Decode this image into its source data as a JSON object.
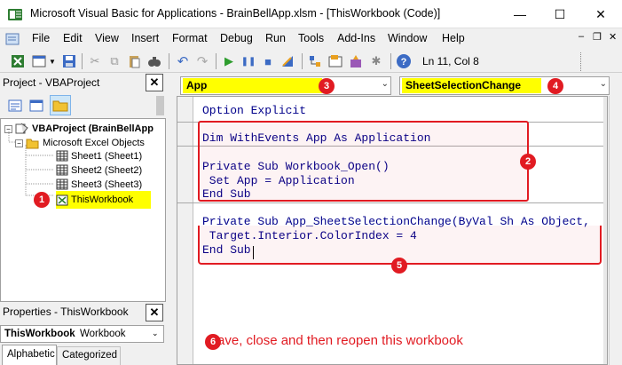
{
  "window": {
    "title": "Microsoft Visual Basic for Applications - BrainBellApp.xlsm - [ThisWorkbook (Code)]",
    "minimize": "—",
    "maximize": "☐",
    "close": "✕"
  },
  "menu": {
    "items": [
      "File",
      "Edit",
      "View",
      "Insert",
      "Format",
      "Debug",
      "Run",
      "Tools",
      "Add-Ins",
      "Window",
      "Help"
    ],
    "doc_min": "–",
    "doc_restore": "❐",
    "doc_close": "✕"
  },
  "toolbar": {
    "status": "Ln 11, Col 8"
  },
  "project": {
    "title": "Project - VBAProject",
    "close": "✕",
    "root": "VBAProject (BrainBellApp",
    "folder": "Microsoft Excel Objects",
    "sheets": [
      "Sheet1 (Sheet1)",
      "Sheet2 (Sheet2)",
      "Sheet3 (Sheet3)"
    ],
    "this_workbook": "ThisWorkbook"
  },
  "properties": {
    "title": "Properties - ThisWorkbook",
    "close": "✕",
    "object_name": "ThisWorkbook",
    "object_type": "Workbook",
    "tabs": [
      "Alphabetic",
      "Categorized"
    ]
  },
  "code_window": {
    "object_dropdown": "App",
    "procedure_dropdown": "SheetSelectionChange",
    "lines": {
      "l1": "Option Explicit",
      "l2": "Dim WithEvents App As Application",
      "l3": "Private Sub Workbook_Open()",
      "l4": " Set App = Application",
      "l5": "End Sub",
      "l6": "Private Sub App_SheetSelectionChange(ByVal Sh As Object,",
      "l7": " Target.Interior.ColorIndex = 4",
      "l8": "End Sub"
    },
    "note": "Save, close and then reopen this workbook"
  },
  "badges": [
    "1",
    "2",
    "3",
    "4",
    "5",
    "6"
  ],
  "colors": {
    "badge": "#e11b22",
    "highlight": "#ffff00",
    "keyword": "#00008b",
    "note_text": "#e11b22"
  }
}
